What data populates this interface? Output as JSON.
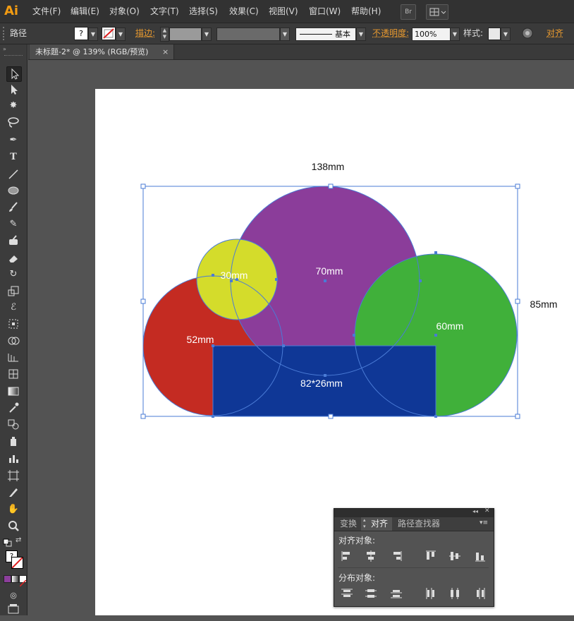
{
  "app": {
    "logo": "Ai"
  },
  "menu": [
    "文件(F)",
    "编辑(E)",
    "对象(O)",
    "文字(T)",
    "选择(S)",
    "效果(C)",
    "视图(V)",
    "窗口(W)",
    "帮助(H)"
  ],
  "menubar_buttons": {
    "bridge": "Br"
  },
  "control_bar": {
    "selection_type": "路径",
    "fill_value": "?",
    "stroke_label": "描边:",
    "stroke_profile": "基本",
    "opacity_label": "不透明度:",
    "opacity_value": "100%",
    "style_label": "样式:",
    "align_label": "对齐"
  },
  "document_tab": {
    "title": "未标题-2* @ 139% (RGB/预览)",
    "close": "×"
  },
  "artwork": {
    "colors": {
      "red": "#c42b22",
      "yellow": "#d4dc2b",
      "purple": "#8b3d9a",
      "green": "#40b03a",
      "blue": "#0f3796",
      "selection": "#4a7bd6"
    },
    "labels": {
      "width": "138mm",
      "height": "85mm",
      "circle_small": "30mm",
      "circle_large": "70mm",
      "circle_left": "52mm",
      "circle_right": "60mm",
      "rect": "82*26mm"
    }
  },
  "align_panel": {
    "tabs": [
      "变换",
      "对齐",
      "路径查找器"
    ],
    "active_tab": "对齐",
    "section_align": "对齐对象:",
    "section_distribute": "分布对象:"
  }
}
